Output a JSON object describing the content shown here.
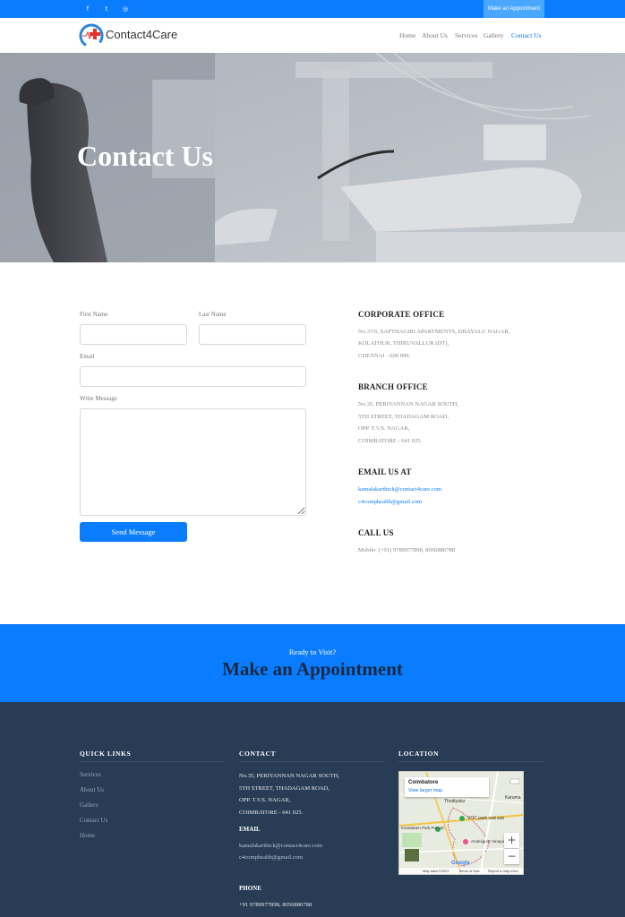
{
  "topbar": {
    "social": [
      {
        "name": "facebook-icon",
        "glyph": "f"
      },
      {
        "name": "twitter-icon",
        "glyph": "t"
      },
      {
        "name": "instagram-icon",
        "glyph": "◎"
      }
    ],
    "appointment_label": "Make an Appointment"
  },
  "header": {
    "logo_text": "Contact4Care",
    "nav": [
      {
        "label": "Home",
        "active": false
      },
      {
        "label": "About Us",
        "active": false
      },
      {
        "label": "Services",
        "active": false
      },
      {
        "label": "Gallery",
        "active": false
      },
      {
        "label": "Contact Us",
        "active": true
      }
    ]
  },
  "hero": {
    "title": "Contact Us"
  },
  "form": {
    "first_name_label": "First Name",
    "last_name_label": "Last Name",
    "email_label": "Email",
    "message_label": "Write Message",
    "first_name_value": "",
    "last_name_value": "",
    "email_value": "",
    "message_value": "",
    "submit_label": "Send Message"
  },
  "offices": {
    "corporate": {
      "heading": "CORPORATE OFFICE",
      "lines": [
        "No.37/6, SAPTHAGIRI APARTMENTS, DHAYALU NAGAR,",
        "KOLATHUR, THIRUVALLUR (DT),",
        "CHENNAI - 600 099."
      ]
    },
    "branch": {
      "heading": "BRANCH OFFICE",
      "lines": [
        "No.35, PERIYANNAN NAGAR SOUTH,",
        "5TH STREET, THADAGAM ROAD,",
        "OPP. T.V.S. NAGAR,",
        "COIMBATORE - 641 025."
      ]
    },
    "email": {
      "heading": "EMAIL US AT",
      "emails": [
        "kamalakarthick@contact4care.com",
        "c4comphealth@gmail.com"
      ]
    },
    "call": {
      "heading": "CALL US",
      "text": "Mobile: (+91) 9789977898, 8056886788"
    }
  },
  "banner": {
    "subtitle": "Ready to Visit?",
    "title": "Make an Appointment"
  },
  "footer": {
    "quick_links_heading": "QUICK LINKS",
    "quick_links": [
      "Services",
      "About Us",
      "Gallery",
      "Contact Us",
      "Home"
    ],
    "contact_heading": "CONTACT",
    "contact_lines": [
      "No.35, PERIYANNAN NAGAR SOUTH,",
      "5TH STREET, THADAGAM ROAD,",
      "OPP. T.V.S. NAGAR,",
      "COIMBATORE - 641 025."
    ],
    "email_heading": "EMAIL",
    "emails": [
      "kamalakarthick@contact4care.com",
      "c4comphealth@gmail.com"
    ],
    "phone_heading": "PHONE",
    "phone": "+91 9789977898, 8056886788",
    "location_heading": "LOCATION",
    "map": {
      "place": "Coimbatore",
      "view_larger": "View larger map",
      "labels": [
        "Thudiyalur",
        "Karuma",
        "VOC park and zoo",
        "Kondattam Park Pvt Ltd",
        "Arulmigu E Vinayagar T"
      ],
      "zoom_in": "+",
      "zoom_out": "−",
      "footer": [
        "Google",
        "Map data ©2021",
        "Terms of Use",
        "Report a map error"
      ]
    }
  },
  "colors": {
    "primary": "#0a7cff",
    "footer_bg": "#283c55",
    "banner_title": "#1a2a44"
  }
}
